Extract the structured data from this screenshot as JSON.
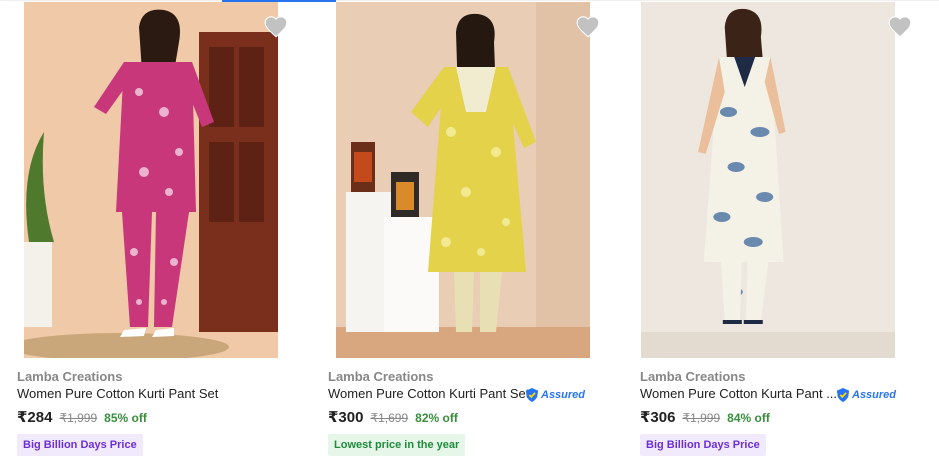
{
  "products": [
    {
      "brand": "Lamba Creations",
      "title": "Women Pure Cotton Kurti Pant Set",
      "assured": false,
      "price": "₹284",
      "mrp": "₹1,999",
      "discount": "85% off",
      "badge": "Big Billion Days Price",
      "badge_style": "purple",
      "outfit_color": "#c8377a"
    },
    {
      "brand": "Lamba Creations",
      "title": "Women Pure Cotton Kurti Pant Set",
      "assured": true,
      "assured_label": "Assured",
      "price": "₹300",
      "mrp": "₹1,699",
      "discount": "82% off",
      "badge": "Lowest price in the year",
      "badge_style": "green",
      "outfit_color": "#e3d24a"
    },
    {
      "brand": "Lamba Creations",
      "title": "Women Pure Cotton Kurta Pant ...",
      "assured": true,
      "assured_label": "Assured",
      "price": "₹306",
      "mrp": "₹1,999",
      "discount": "84% off",
      "badge": "Big Billion Days Price",
      "badge_style": "purple",
      "outfit_color": "#5b7fa8"
    }
  ],
  "icons": {
    "wishlist": "heart-icon",
    "assured": "assured-shield-icon"
  },
  "colors": {
    "accent": "#2874f0",
    "discount_green": "#388e3c",
    "brand_grey": "#878787"
  }
}
